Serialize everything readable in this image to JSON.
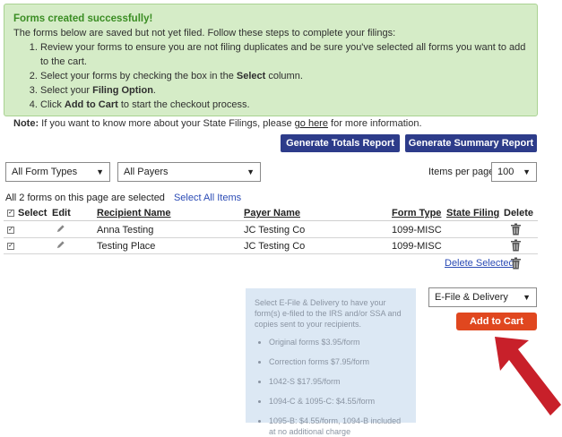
{
  "notice": {
    "title": "Forms created successfully!",
    "intro": "The forms below are saved but not yet filed. Follow these steps to complete your filings:",
    "step1": "Review your forms to ensure you are not filing duplicates and be sure you've selected all forms you want to add to the cart.",
    "step2_a": "Select your forms by checking the box in the ",
    "step2_b": "Select",
    "step2_c": " column.",
    "step3_a": "Select your ",
    "step3_b": "Filing Option",
    "step3_c": ".",
    "step4_a": "Click ",
    "step4_b": "Add to Cart",
    "step4_c": " to start the checkout process.",
    "note_label": "Note:",
    "note_a": " If you want to know more about your State Filings, please ",
    "note_link": "go here",
    "note_b": " for more information."
  },
  "actions": {
    "totals_report": "Generate Totals Report",
    "summary_report": "Generate Summary Report"
  },
  "filters": {
    "form_types": "All Form Types",
    "payers": "All Payers",
    "items_per_page_label": "Items per page:",
    "items_per_page_value": "100"
  },
  "selection": {
    "status": "All 2 forms on this page are selected",
    "select_all": "Select All Items"
  },
  "table": {
    "headers": {
      "select": "Select",
      "edit": "Edit",
      "recipient": "Recipient Name",
      "payer": "Payer Name",
      "form_type": "Form Type",
      "state_filing": "State Filing",
      "delete": "Delete"
    },
    "rows": [
      {
        "recipient": "Anna Testing",
        "payer": "JC Testing Co",
        "form_type": "1099-MISC",
        "state_filing": ""
      },
      {
        "recipient": "Testing Place",
        "payer": "JC Testing Co",
        "form_type": "1099-MISC",
        "state_filing": ""
      }
    ],
    "delete_selected": "Delete Selected"
  },
  "promo": {
    "text": "Select E-File & Delivery to have your form(s) e-filed to the IRS and/or SSA and copies sent to your recipients.",
    "items": [
      "Original forms $3.95/form",
      "Correction forms $7.95/form",
      "1042-S $17.95/form",
      "1094-C & 1095-C: $4.55/form",
      "1095-B: $4.55/form, 1094-B included at no additional charge"
    ]
  },
  "cart": {
    "filing_option": "E-File & Delivery",
    "add_to_cart": "Add to Cart"
  },
  "colors": {
    "success_bg": "#d5ecc7",
    "navy_button": "#2d3c8a",
    "cart_button": "#e0471f",
    "arrow": "#c8202a"
  }
}
